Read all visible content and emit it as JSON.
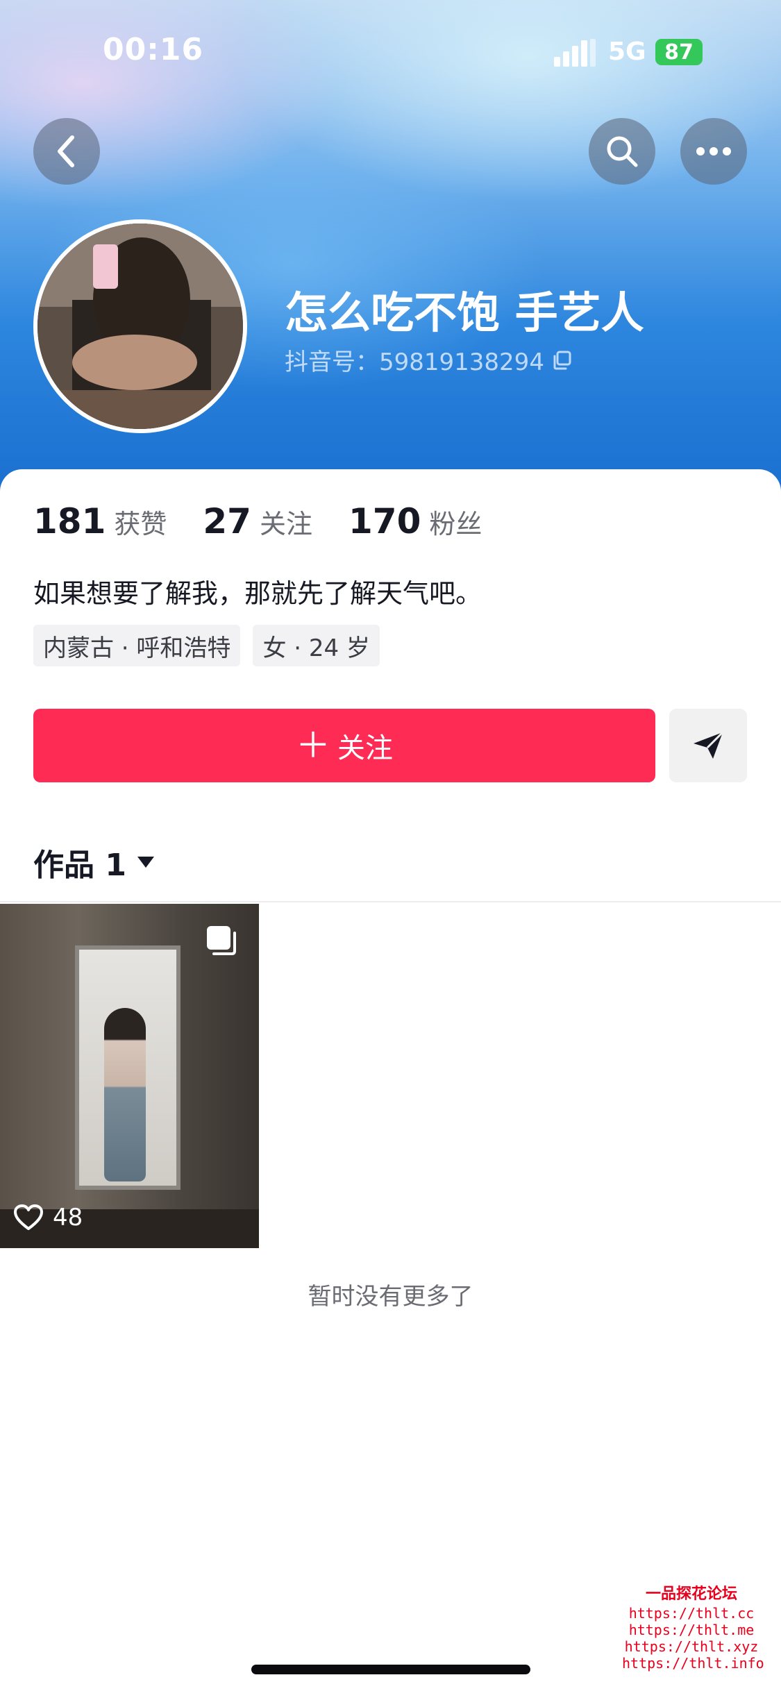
{
  "status_bar": {
    "time": "00:16",
    "network": "5G",
    "battery": "87"
  },
  "nav": {
    "back_icon": "chevron-left-icon",
    "search_icon": "search-icon",
    "more_icon": "more-dots-icon"
  },
  "profile": {
    "nickname": "怎么吃不饱  手艺人",
    "douyin_id": "抖音号：59819138294"
  },
  "stats": [
    {
      "value": "181",
      "label": "获赞"
    },
    {
      "value": "27",
      "label": "关注"
    },
    {
      "value": "170",
      "label": "粉丝"
    }
  ],
  "bio": "如果想要了解我，那就先了解天气吧。",
  "tags": [
    "内蒙古 · 呼和浩特",
    "女 · 24 岁"
  ],
  "actions": {
    "follow_label": "关注",
    "share_icon": "send-icon"
  },
  "works": {
    "tab_label": "作品 1",
    "items": [
      {
        "likes": "48"
      }
    ],
    "end_text": "暂时没有更多了"
  },
  "watermark": {
    "title": "一品探花论坛",
    "links": [
      "https://thlt.cc",
      "https://thlt.me",
      "https://thlt.xyz",
      "https://thlt.info"
    ]
  },
  "colors": {
    "accent": "#fe2c55",
    "battery": "#34c759"
  }
}
